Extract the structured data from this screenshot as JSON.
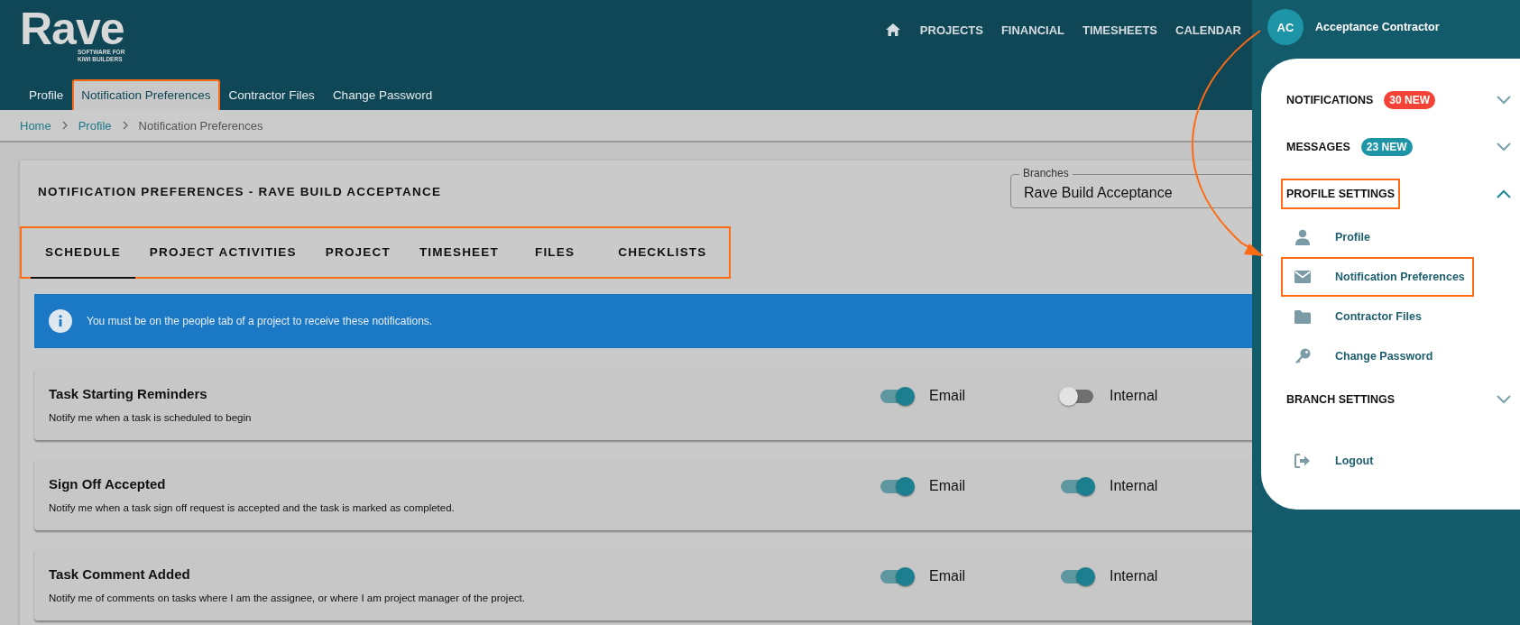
{
  "logo": {
    "name": "Rave",
    "tagline": [
      "SOFTWARE FOR",
      "KIWI BUILDERS"
    ]
  },
  "top_nav": [
    "PROJECTS",
    "FINANCIAL",
    "TIMESHEETS",
    "CALENDAR"
  ],
  "sub_nav": [
    {
      "label": "Profile",
      "selected": false,
      "highlighted": false
    },
    {
      "label": "Notification Preferences",
      "selected": true,
      "highlighted": true
    },
    {
      "label": "Contractor Files",
      "selected": false,
      "highlighted": false
    },
    {
      "label": "Change Password",
      "selected": false,
      "highlighted": false
    }
  ],
  "breadcrumb": [
    {
      "label": "Home",
      "link": true
    },
    {
      "label": "Profile",
      "link": true
    },
    {
      "label": "Notification Preferences",
      "link": false
    }
  ],
  "page_title": "NOTIFICATION PREFERENCES - RAVE BUILD ACCEPTANCE",
  "branches": {
    "label": "Branches",
    "value": "Rave Build Acceptance"
  },
  "tabs_highlighted": true,
  "tabs": [
    {
      "label": "SCHEDULE",
      "selected": true
    },
    {
      "label": "PROJECT ACTIVITIES",
      "selected": false
    },
    {
      "label": "PROJECT",
      "selected": false
    },
    {
      "label": "TIMESHEET",
      "selected": false
    },
    {
      "label": "FILES",
      "selected": false
    },
    {
      "label": "CHECKLISTS",
      "selected": false
    }
  ],
  "info": "You must be on the people tab of a project to receive these notifications.",
  "preferences": [
    {
      "title": "Task Starting Reminders",
      "description": "Notify me when a task is scheduled to begin",
      "toggles": [
        {
          "label": "Email",
          "on": true
        },
        {
          "label": "Internal",
          "on": false
        }
      ]
    },
    {
      "title": "Sign Off Accepted",
      "description": "Notify me when a task sign off request is accepted and the task is marked as completed.",
      "toggles": [
        {
          "label": "Email",
          "on": true
        },
        {
          "label": "Internal",
          "on": true
        }
      ]
    },
    {
      "title": "Task Comment Added",
      "description": "Notify me of comments on tasks where I am the assignee, or where I am project manager of the project.",
      "toggles": [
        {
          "label": "Email",
          "on": true
        },
        {
          "label": "Internal",
          "on": true
        }
      ]
    }
  ],
  "user": {
    "initials": "AC",
    "name": "Acceptance Contractor"
  },
  "menu": [
    {
      "kind": "section",
      "title": "NOTIFICATIONS",
      "badge": "30 NEW",
      "color": "#f44336",
      "expanded": false,
      "highlighted": false
    },
    {
      "kind": "section",
      "title": "MESSAGES",
      "badge": "23 NEW",
      "color": "#1e95a6",
      "expanded": false,
      "highlighted": false
    },
    {
      "kind": "section",
      "title": "PROFILE SETTINGS",
      "expanded": true,
      "highlighted": true,
      "children": [
        {
          "kind": "person",
          "label": "Profile",
          "highlighted": false
        },
        {
          "kind": "envelope",
          "label": "Notification Preferences",
          "highlighted": true
        },
        {
          "kind": "folder",
          "label": "Contractor Files",
          "highlighted": false
        },
        {
          "kind": "key",
          "label": "Change Password",
          "highlighted": false
        }
      ]
    },
    {
      "kind": "section",
      "title": "BRANCH SETTINGS",
      "expanded": false,
      "highlighted": false
    },
    {
      "kind": "logout",
      "label": "Logout"
    }
  ],
  "annotation_arrow": true
}
